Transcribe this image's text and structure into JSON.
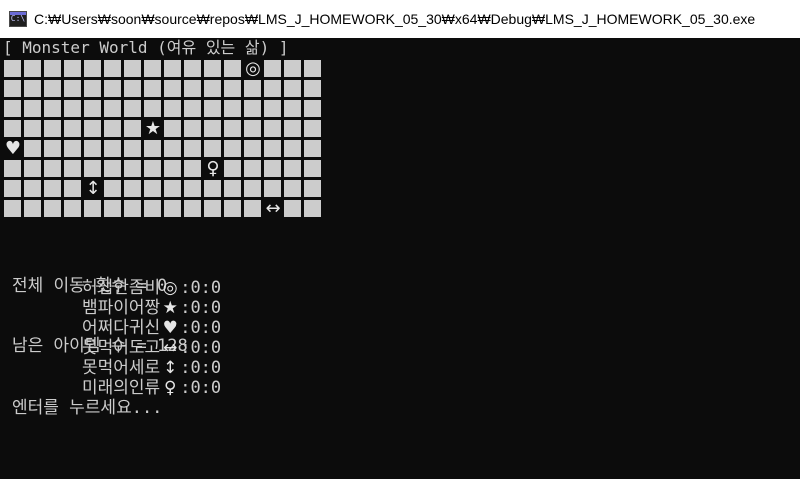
{
  "window": {
    "app_icon_text": "C:\\",
    "title": "C:₩Users₩soon₩source₩repos₩LMS_J_HOMEWORK_05_30₩x64₩Debug₩LMS_J_HOMEWORK_05_30.exe"
  },
  "console": {
    "header": "[ Monster World (여유 있는 삶) ]",
    "grid": {
      "cols": 16,
      "rows": 8,
      "cells": [
        "",
        "",
        "",
        "",
        "",
        "",
        "",
        "",
        "",
        "",
        "",
        "",
        "◎",
        "",
        "",
        "",
        "",
        "",
        "",
        "",
        "",
        "",
        "",
        "",
        "",
        "",
        "",
        "",
        "",
        "",
        "",
        "",
        "",
        "",
        "",
        "",
        "",
        "",
        "",
        "",
        "",
        "",
        "",
        "",
        "",
        "",
        "",
        "",
        "",
        "",
        "",
        "",
        "",
        "",
        "",
        "★",
        "",
        "",
        "",
        "",
        "",
        "",
        "",
        "",
        "♥",
        "",
        "",
        "",
        "",
        "",
        "",
        "",
        "",
        "",
        "",
        "",
        "",
        "",
        "",
        "",
        "",
        "",
        "",
        "",
        "",
        "",
        "",
        "",
        "",
        "",
        "♀",
        "",
        "",
        "",
        "",
        "",
        "",
        "",
        "",
        "",
        "↕",
        "",
        "",
        "",
        "",
        "",
        "",
        "",
        "",
        "",
        "",
        "",
        "",
        "",
        "",
        "",
        "",
        "",
        "",
        "",
        "",
        "",
        "",
        "",
        "",
        "↔",
        "",
        ""
      ]
    },
    "stats": {
      "total_moves": "전체 이동 횟수 = 0",
      "items_left": "남은 아이템 수 = 128"
    },
    "legend": [
      {
        "name": "허접한좀비",
        "icon": "◎",
        "count": ":0:0"
      },
      {
        "name": "뱀파이어짱",
        "icon": "★",
        "count": ":0:0"
      },
      {
        "name": "어쩌다귀신",
        "icon": "♥",
        "count": ":0:0"
      },
      {
        "name": "못먹어도고",
        "icon": "↔",
        "count": ":0:0"
      },
      {
        "name": "못먹어세로",
        "icon": "↕",
        "count": ":0:0"
      },
      {
        "name": "미래의인류",
        "icon": "♀",
        "count": ":0:0"
      }
    ],
    "prompt": "엔터를 누르세요..."
  }
}
